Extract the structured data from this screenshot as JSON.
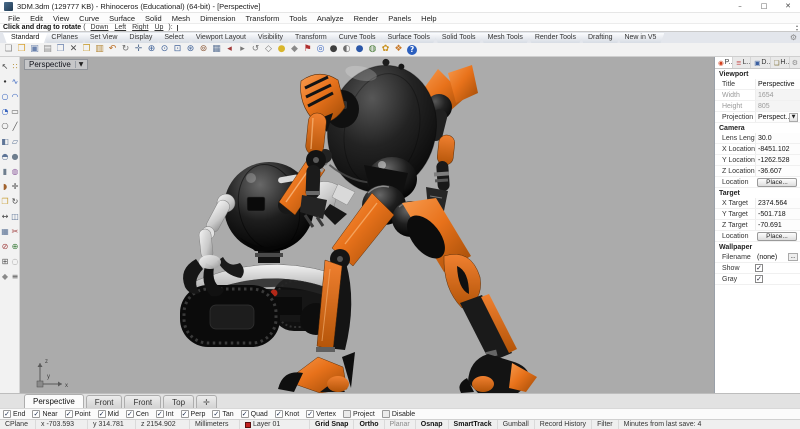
{
  "window": {
    "title": "3DM.3dm (129777 KB) - Rhinoceros (Educational) (64-bit) - [Perspective]",
    "controls": {
      "minimize": "–",
      "maximize": "□",
      "close": "✕"
    }
  },
  "menu": {
    "items": [
      {
        "label": "File",
        "name": "menu-file"
      },
      {
        "label": "Edit",
        "name": "menu-edit"
      },
      {
        "label": "View",
        "name": "menu-view"
      },
      {
        "label": "Curve",
        "name": "menu-curve"
      },
      {
        "label": "Surface",
        "name": "menu-surface"
      },
      {
        "label": "Solid",
        "name": "menu-solid"
      },
      {
        "label": "Mesh",
        "name": "menu-mesh"
      },
      {
        "label": "Dimension",
        "name": "menu-dimension"
      },
      {
        "label": "Transform",
        "name": "menu-transform"
      },
      {
        "label": "Tools",
        "name": "menu-tools"
      },
      {
        "label": "Analyze",
        "name": "menu-analyze"
      },
      {
        "label": "Render",
        "name": "menu-render"
      },
      {
        "label": "Panels",
        "name": "menu-panels"
      },
      {
        "label": "Help",
        "name": "menu-help"
      }
    ]
  },
  "command": {
    "prompt": "Click and drag to rotate",
    "open_paren": "(",
    "options": [
      {
        "label": "Down",
        "name": "command-option-down"
      },
      {
        "label": "Left",
        "name": "command-option-left"
      },
      {
        "label": "Right",
        "name": "command-option-right"
      },
      {
        "label": "Up",
        "name": "command-option-up"
      }
    ],
    "close_paren": "):",
    "spinner_up": "▴",
    "spinner_down": "▾"
  },
  "toolbar_tabs": {
    "gear": "⚙",
    "items": [
      {
        "label": "Standard",
        "cls": "active",
        "name": "tab-standard"
      },
      {
        "label": "CPlanes",
        "cls": "",
        "name": "tab-cplanes"
      },
      {
        "label": "Set View",
        "cls": "",
        "name": "tab-set-view"
      },
      {
        "label": "Display",
        "cls": "",
        "name": "tab-display"
      },
      {
        "label": "Select",
        "cls": "",
        "name": "tab-select"
      },
      {
        "label": "Viewport Layout",
        "cls": "",
        "name": "tab-viewport-layout"
      },
      {
        "label": "Visibility",
        "cls": "",
        "name": "tab-visibility"
      },
      {
        "label": "Transform",
        "cls": "",
        "name": "tab-transform"
      },
      {
        "label": "Curve Tools",
        "cls": "",
        "name": "tab-curve-tools"
      },
      {
        "label": "Surface Tools",
        "cls": "",
        "name": "tab-surface-tools"
      },
      {
        "label": "Solid Tools",
        "cls": "",
        "name": "tab-solid-tools"
      },
      {
        "label": "Mesh Tools",
        "cls": "",
        "name": "tab-mesh-tools"
      },
      {
        "label": "Render Tools",
        "cls": "",
        "name": "tab-render-tools"
      },
      {
        "label": "Drafting",
        "cls": "",
        "name": "tab-drafting"
      },
      {
        "label": "New in V5",
        "cls": "",
        "name": "tab-new-in-v5"
      }
    ]
  },
  "toolbar": {
    "icons": [
      {
        "name": "new-file-icon",
        "glyph": "❏",
        "color": "#909090",
        "cls": ""
      },
      {
        "name": "open-file-icon",
        "glyph": "❒",
        "color": "#D9A334",
        "cls": ""
      },
      {
        "name": "save-icon",
        "glyph": "▣",
        "color": "#6B83AE",
        "cls": ""
      },
      {
        "name": "print-icon",
        "glyph": "▤",
        "color": "#8F8F8F",
        "cls": ""
      },
      {
        "name": "copy-clipboard-icon",
        "glyph": "❐",
        "color": "#7A8FB5",
        "cls": ""
      },
      {
        "name": "delete-icon",
        "glyph": "✕",
        "color": "#4a4a4a",
        "cls": ""
      },
      {
        "name": "copy-icon",
        "glyph": "❐",
        "color": "#C9A13A",
        "cls": ""
      },
      {
        "name": "paste-icon",
        "glyph": "▥",
        "color": "#B5893A",
        "cls": ""
      },
      {
        "name": "undo-icon",
        "glyph": "↶",
        "color": "#B86A20",
        "cls": ""
      },
      {
        "name": "orbit-view-icon",
        "glyph": "↻",
        "color": "#707070",
        "cls": ""
      },
      {
        "name": "pan-view-icon",
        "glyph": "✛",
        "color": "#5E7597",
        "cls": ""
      },
      {
        "name": "zoom-in-icon",
        "glyph": "⊕",
        "color": "#44659A",
        "cls": ""
      },
      {
        "name": "zoom-dynamic-icon",
        "glyph": "⊙",
        "color": "#44659A",
        "cls": ""
      },
      {
        "name": "zoom-window-icon",
        "glyph": "⊡",
        "color": "#44659A",
        "cls": ""
      },
      {
        "name": "zoom-extents-icon",
        "glyph": "⊛",
        "color": "#44659A",
        "cls": ""
      },
      {
        "name": "zoom-selected-icon",
        "glyph": "⊚",
        "color": "#8E5E3E",
        "cls": ""
      },
      {
        "name": "viewport-layout-icon",
        "glyph": "▦",
        "color": "#5E7597",
        "cls": ""
      },
      {
        "name": "undo-view-icon",
        "glyph": "◂",
        "color": "#A03838",
        "cls": ""
      },
      {
        "name": "redo-view-icon",
        "glyph": "▸",
        "color": "#787878",
        "cls": ""
      },
      {
        "name": "rotate-view-icon",
        "glyph": "↺",
        "color": "#787878",
        "cls": ""
      },
      {
        "name": "named-view-icon",
        "glyph": "◇",
        "color": "#787878",
        "cls": ""
      },
      {
        "name": "lamp-visibility-icon",
        "glyph": "●",
        "color": "#D9B62C",
        "cls": ""
      },
      {
        "name": "lock-objects-icon",
        "glyph": "◆",
        "color": "#8A8A8A",
        "cls": ""
      },
      {
        "name": "hide-objects-icon",
        "glyph": "⚑",
        "color": "#B03030",
        "cls": ""
      },
      {
        "name": "render-icon",
        "glyph": "◎",
        "color": "#3A66C0",
        "cls": ""
      },
      {
        "name": "shaded-display-icon",
        "glyph": "●",
        "color": "#3E3E3E",
        "cls": ""
      },
      {
        "name": "ghosted-display-icon",
        "glyph": "◐",
        "color": "#6E6E6E",
        "cls": ""
      },
      {
        "name": "rendered-display-icon",
        "glyph": "●",
        "color": "#2B57A8",
        "cls": ""
      },
      {
        "name": "xray-display-icon",
        "glyph": "◍",
        "color": "#4E7E3E",
        "cls": ""
      },
      {
        "name": "options-icon",
        "glyph": "✿",
        "color": "#C8901C",
        "cls": ""
      },
      {
        "name": "link-blocks-icon",
        "glyph": "❖",
        "color": "#C87828",
        "cls": ""
      },
      {
        "name": "help-icon",
        "glyph": "?",
        "color": "#FFFFFF",
        "cls": "help-icon"
      }
    ]
  },
  "sidebar": {
    "icons": [
      {
        "name": "select-tool-icon",
        "glyph": "↖",
        "color": "#444444"
      },
      {
        "name": "points-on-icon",
        "glyph": "∷",
        "color": "#B0882A"
      },
      {
        "name": "point-tool-icon",
        "glyph": "∙",
        "color": "#333333"
      },
      {
        "name": "curve-tool-icon",
        "glyph": "∿",
        "color": "#3A66C0"
      },
      {
        "name": "circle-tool-icon",
        "glyph": "○",
        "color": "#3A66C0"
      },
      {
        "name": "arc-tool-icon",
        "glyph": "◠",
        "color": "#3A66C0"
      },
      {
        "name": "ellipse-tool-icon",
        "glyph": "◔",
        "color": "#3A66C0"
      },
      {
        "name": "rectangle-tool-icon",
        "glyph": "▭",
        "color": "#555555"
      },
      {
        "name": "polygon-tool-icon",
        "glyph": "⎔",
        "color": "#555555"
      },
      {
        "name": "line-tool-icon",
        "glyph": "╱",
        "color": "#555555"
      },
      {
        "name": "surface-tool-icon",
        "glyph": "◧",
        "color": "#5E7597"
      },
      {
        "name": "plane-tool-icon",
        "glyph": "▱",
        "color": "#5E7597"
      },
      {
        "name": "extrude-tool-icon",
        "glyph": "◓",
        "color": "#5E7597"
      },
      {
        "name": "sphere-tool-icon",
        "glyph": "●",
        "color": "#6E7E8E"
      },
      {
        "name": "cylinder-tool-icon",
        "glyph": "▮",
        "color": "#6E7E8E"
      },
      {
        "name": "boolean-tool-icon",
        "glyph": "◍",
        "color": "#8E5E9E"
      },
      {
        "name": "fillet-tool-icon",
        "glyph": "◗",
        "color": "#A0622E"
      },
      {
        "name": "move-tool-icon",
        "glyph": "✛",
        "color": "#444444"
      },
      {
        "name": "copy-tool-icon",
        "glyph": "❐",
        "color": "#C9A13A"
      },
      {
        "name": "rotate-tool-icon",
        "glyph": "↻",
        "color": "#444444"
      },
      {
        "name": "scale-tool-icon",
        "glyph": "↔",
        "color": "#444444"
      },
      {
        "name": "mirror-tool-icon",
        "glyph": "◫",
        "color": "#5E7597"
      },
      {
        "name": "array-tool-icon",
        "glyph": "▦",
        "color": "#5E7597"
      },
      {
        "name": "trim-tool-icon",
        "glyph": "✂",
        "color": "#A04040"
      },
      {
        "name": "split-tool-icon",
        "glyph": "⊘",
        "color": "#A04040"
      },
      {
        "name": "join-tool-icon",
        "glyph": "⊕",
        "color": "#3E7E3E"
      },
      {
        "name": "group-tool-icon",
        "glyph": "⊞",
        "color": "#555555"
      },
      {
        "name": "hide-tool-icon",
        "glyph": "◌",
        "color": "#777777"
      },
      {
        "name": "lock-tool-icon",
        "glyph": "◆",
        "color": "#8A8A8A"
      },
      {
        "name": "properties-tool-icon",
        "glyph": "≡",
        "color": "#555555"
      }
    ]
  },
  "viewport": {
    "label": "Perspective",
    "dropdown_glyph": "▼",
    "axis": {
      "x": "x",
      "y": "y",
      "z": "z"
    }
  },
  "panel": {
    "gear": "⚙",
    "tabs": [
      {
        "label": "P...",
        "icon": "◉",
        "color": "#D2401E",
        "cls": "active",
        "name": "panel-tab-properties"
      },
      {
        "label": "L...",
        "icon": "≡",
        "color": "#C03030",
        "cls": "",
        "name": "panel-tab-layers"
      },
      {
        "label": "D...",
        "icon": "▣",
        "color": "#3A5FA0",
        "cls": "",
        "name": "panel-tab-display"
      },
      {
        "label": "H...",
        "icon": "❏",
        "color": "#7A6A30",
        "cls": "",
        "name": "panel-tab-help"
      }
    ],
    "viewport_section": {
      "header": "Viewport",
      "title_label": "Title",
      "title_value": "Perspective",
      "width_label": "Width",
      "width_value": "1654",
      "height_label": "Height",
      "height_value": "805",
      "projection_label": "Projection",
      "projection_value": "Perspect...",
      "projection_dd": "▼"
    },
    "camera_section": {
      "header": "Camera",
      "lens_label": "Lens Length",
      "lens_value": "30.0",
      "x_label": "X Location",
      "x_value": "-8451.102",
      "y_label": "Y Location",
      "y_value": "-1262.528",
      "z_label": "Z Location",
      "z_value": "-36.607",
      "location_label": "Location",
      "place_button": "Place..."
    },
    "target_section": {
      "header": "Target",
      "x_label": "X Target",
      "x_value": "2374.564",
      "y_label": "Y Target",
      "y_value": "-501.718",
      "z_label": "Z Target",
      "z_value": "-70.691",
      "location_label": "Location",
      "place_button": "Place..."
    },
    "wallpaper_section": {
      "header": "Wallpaper",
      "filename_label": "Filename",
      "filename_value": "(none)",
      "browse_button": "...",
      "show_label": "Show",
      "gray_label": "Gray",
      "check_glyph": "✓"
    }
  },
  "viewport_tabs": {
    "items": [
      {
        "label": "Perspective",
        "cls": "active",
        "name": "viewport-tab-perspective"
      },
      {
        "label": "Front",
        "cls": "",
        "name": "viewport-tab-front-1"
      },
      {
        "label": "Front",
        "cls": "",
        "name": "viewport-tab-front-2"
      },
      {
        "label": "Top",
        "cls": "",
        "name": "viewport-tab-top"
      },
      {
        "label": "✛",
        "cls": "plus",
        "name": "viewport-tab-add"
      }
    ]
  },
  "osnap": {
    "items": [
      {
        "label": "End",
        "check": "✓",
        "name": "osnap-end"
      },
      {
        "label": "Near",
        "check": "✓",
        "name": "osnap-near"
      },
      {
        "label": "Point",
        "check": "✓",
        "name": "osnap-point"
      },
      {
        "label": "Mid",
        "check": "✓",
        "name": "osnap-mid"
      },
      {
        "label": "Cen",
        "check": "✓",
        "name": "osnap-cen"
      },
      {
        "label": "Int",
        "check": "✓",
        "name": "osnap-int"
      },
      {
        "label": "Perp",
        "check": "✓",
        "name": "osnap-perp"
      },
      {
        "label": "Tan",
        "check": "✓",
        "name": "osnap-tan"
      },
      {
        "label": "Quad",
        "check": "✓",
        "name": "osnap-quad"
      },
      {
        "label": "Knot",
        "check": "✓",
        "name": "osnap-knot"
      },
      {
        "label": "Vertex",
        "check": "✓",
        "name": "osnap-vertex"
      },
      {
        "label": "Project",
        "check": "",
        "name": "osnap-project"
      },
      {
        "label": "Disable",
        "check": "",
        "name": "osnap-disable"
      }
    ]
  },
  "statusbar": {
    "cplane": "CPlane",
    "x": "x -703.593",
    "y": "y 314.781",
    "z": "z 2154.902",
    "units": "Millimeters",
    "layer": "Layer 01",
    "layer_color": "#C22020",
    "toggles": [
      {
        "label": "Grid Snap",
        "cls": "bold",
        "name": "status-grid-snap"
      },
      {
        "label": "Ortho",
        "cls": "bold",
        "name": "status-ortho"
      },
      {
        "label": "Planar",
        "cls": "dim",
        "name": "status-planar"
      },
      {
        "label": "Osnap",
        "cls": "bold",
        "name": "status-osnap"
      },
      {
        "label": "SmartTrack",
        "cls": "bold",
        "name": "status-smarttrack"
      },
      {
        "label": "Gumball",
        "cls": "",
        "name": "status-gumball"
      },
      {
        "label": "Record History",
        "cls": "",
        "name": "status-record-history"
      },
      {
        "label": "Filter",
        "cls": "",
        "name": "status-filter"
      }
    ],
    "save_info": "Minutes from last save: 4"
  },
  "colors": {
    "accent_orange": "#E8721B",
    "viewport_background": "#ABABAB",
    "layer_swatch": "#C22020",
    "help_blue": "#2B5FBF"
  }
}
